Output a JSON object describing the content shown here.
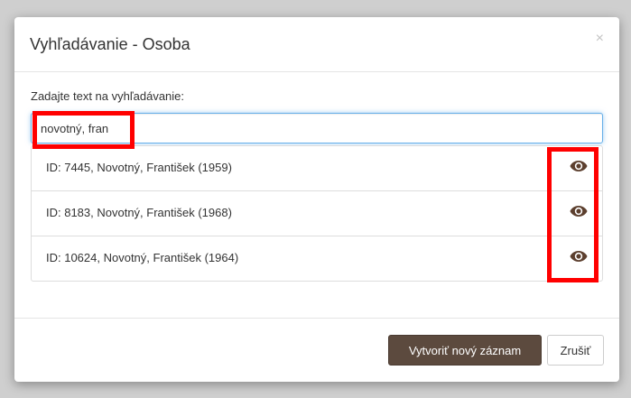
{
  "dialog": {
    "title": "Vyhľadávanie - Osoba",
    "close_label": "×"
  },
  "search": {
    "label": "Zadajte text na vyhľadávanie:",
    "value": "novotný, fran"
  },
  "results": [
    {
      "text": "ID: 7445, Novotný, František (1959)",
      "icon": "eye-icon"
    },
    {
      "text": "ID: 8183, Novotný, František (1968)",
      "icon": "eye-icon"
    },
    {
      "text": "ID: 10624, Novotný, František (1964)",
      "icon": "eye-icon"
    }
  ],
  "footer": {
    "create_label": "Vytvoriť nový záznam",
    "cancel_label": "Zrušiť"
  },
  "colors": {
    "primary_button": "#5c4a3e",
    "eye_icon": "#5c3f2e",
    "highlight": "#ff0000",
    "input_focus": "#66afe9"
  }
}
